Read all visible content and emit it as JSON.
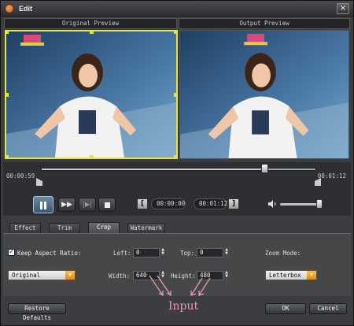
{
  "window": {
    "title": "Edit",
    "close_glyph": "×"
  },
  "preview": {
    "original_label": "Original Preview",
    "output_label": "Output Preview"
  },
  "timeline": {
    "start_time": "00:00:59",
    "end_time": "00:01:12",
    "position_fraction": 0.81
  },
  "controls": {
    "pause_icon": "pause-icon",
    "forward_glyph": "▶▶",
    "step_glyph": "|▶|",
    "bracket_left": "[",
    "bracket_right": "]",
    "time_in": "00:00:00",
    "time_out": "00:01:12",
    "volume_fraction": 0.9
  },
  "tabs": [
    {
      "label": "Effect"
    },
    {
      "label": "Trim"
    },
    {
      "label": "Crop",
      "active": true
    },
    {
      "label": "Watermark"
    }
  ],
  "crop": {
    "keep_aspect_label": "Keep Aspect Ratio:",
    "keep_aspect_checked": true,
    "aspect_value": "Original",
    "left_label": "Left:",
    "left_value": "0",
    "top_label": "Top:",
    "top_value": "0",
    "width_label": "Width:",
    "width_value": "640",
    "height_label": "Height:",
    "height_value": "480",
    "zoom_label": "Zoom Mode:",
    "zoom_value": "Letterbox"
  },
  "footer": {
    "restore_label": "Restore Defaults",
    "ok_label": "OK",
    "cancel_label": "Cancel"
  },
  "annotation": {
    "text": "Input",
    "color": "#e59ab1"
  },
  "colors": {
    "accent_select": "#e38a10",
    "crop_frame": "#e2e44a"
  }
}
